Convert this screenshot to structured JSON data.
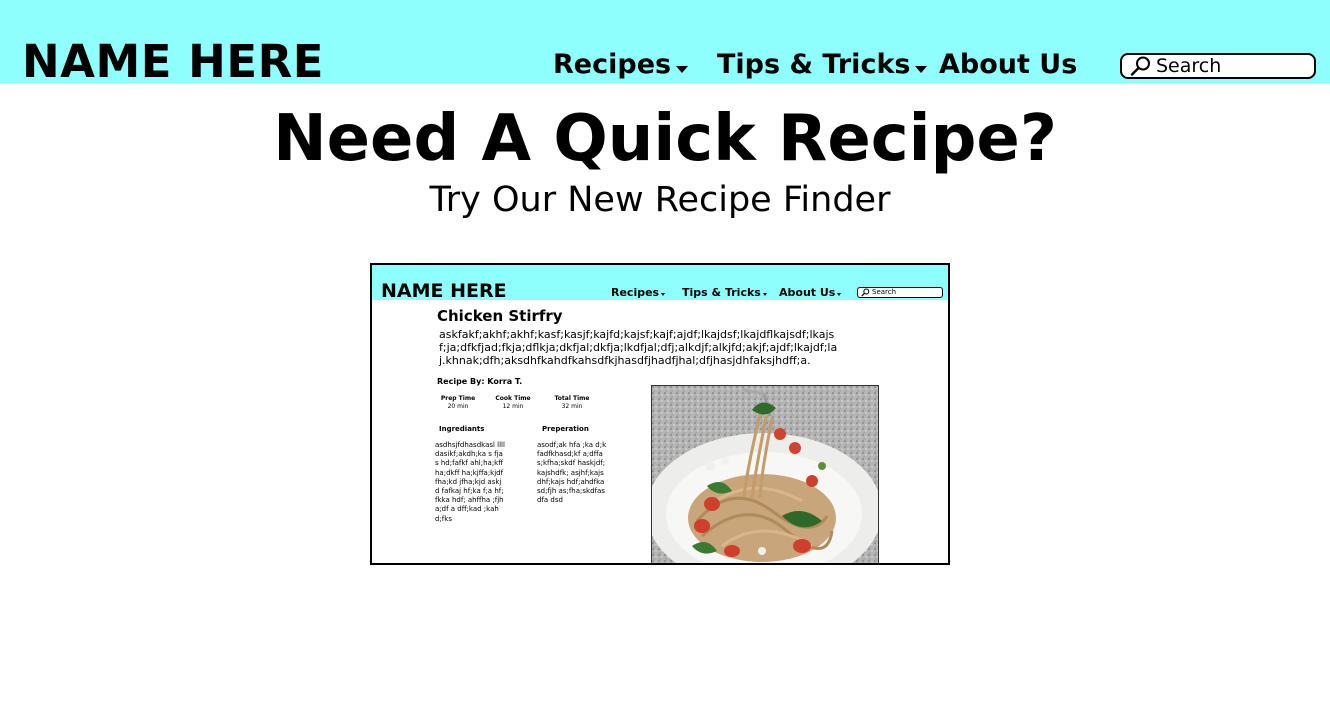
{
  "header": {
    "logo": "NAME HERE",
    "nav": [
      {
        "label": "Recipes",
        "has_dropdown": true
      },
      {
        "label": "Tips & Tricks",
        "has_dropdown": true
      },
      {
        "label": "About Us",
        "has_dropdown": false
      }
    ],
    "search": {
      "placeholder": "Search",
      "icon": "search-icon"
    },
    "background": "#8ffffd"
  },
  "hero": {
    "title": "Need A Quick Recipe?",
    "subtitle": "Try Our New Recipe Finder"
  },
  "preview": {
    "logo": "NAME HERE",
    "nav": [
      {
        "label": "Recipes"
      },
      {
        "label": "Tips & Tricks"
      },
      {
        "label": "About Us"
      }
    ],
    "search_placeholder": "Search",
    "recipe_title": "Chicken Stirfry",
    "description": "askfakf;akhf;akhf;kasf;kasjf;kajfd;kajsf;kajf;ajdf;lkajdsf;lkajdflkajsdf;lkajsf;ja;dfkfjad;fkja;dflkja;dkfjal;dkfja;lkdfjal;dfj;alkdjf;alkjfd;akjf;ajdf;lkajdf;laj.khnak;dfh;aksdhfkahdfkahsdfkjhasdfjhadfjhal;dfjhasjdhfaksjhdff;a.",
    "author": "Recipe By: Korra T.",
    "times": [
      {
        "label": "Prep Time",
        "value": "20 min"
      },
      {
        "label": "Cook Time",
        "value": "12 min"
      },
      {
        "label": "Total Time",
        "value": "32 min"
      }
    ],
    "ingredients_heading": "Ingrediants",
    "ingredients_text": "asdhsjfdhasdkasl lllldasikf;akdh;ka s fjas hd;fafkf ahl;ha;kff ha;dkff ha;kjffa;kjdf fha;kd jfha;kjd askjd fafkaj hf;ka f;a hf;fkka hdf; ahffha ;fjha;df a dff;kad ;kah d;fks",
    "preparation_heading": "Preperation",
    "preparation_text": "asodf;ak hfa ;ka d;kfadfkhasd;kf a;dffas;kfha;skdf haskjdf;kajshdfk; asjhf;kajsdhf;kajs hdf;ahdfkasd;fjh as;fha;skdfasdfa dsd",
    "photo_icon": "pasta-photo"
  }
}
